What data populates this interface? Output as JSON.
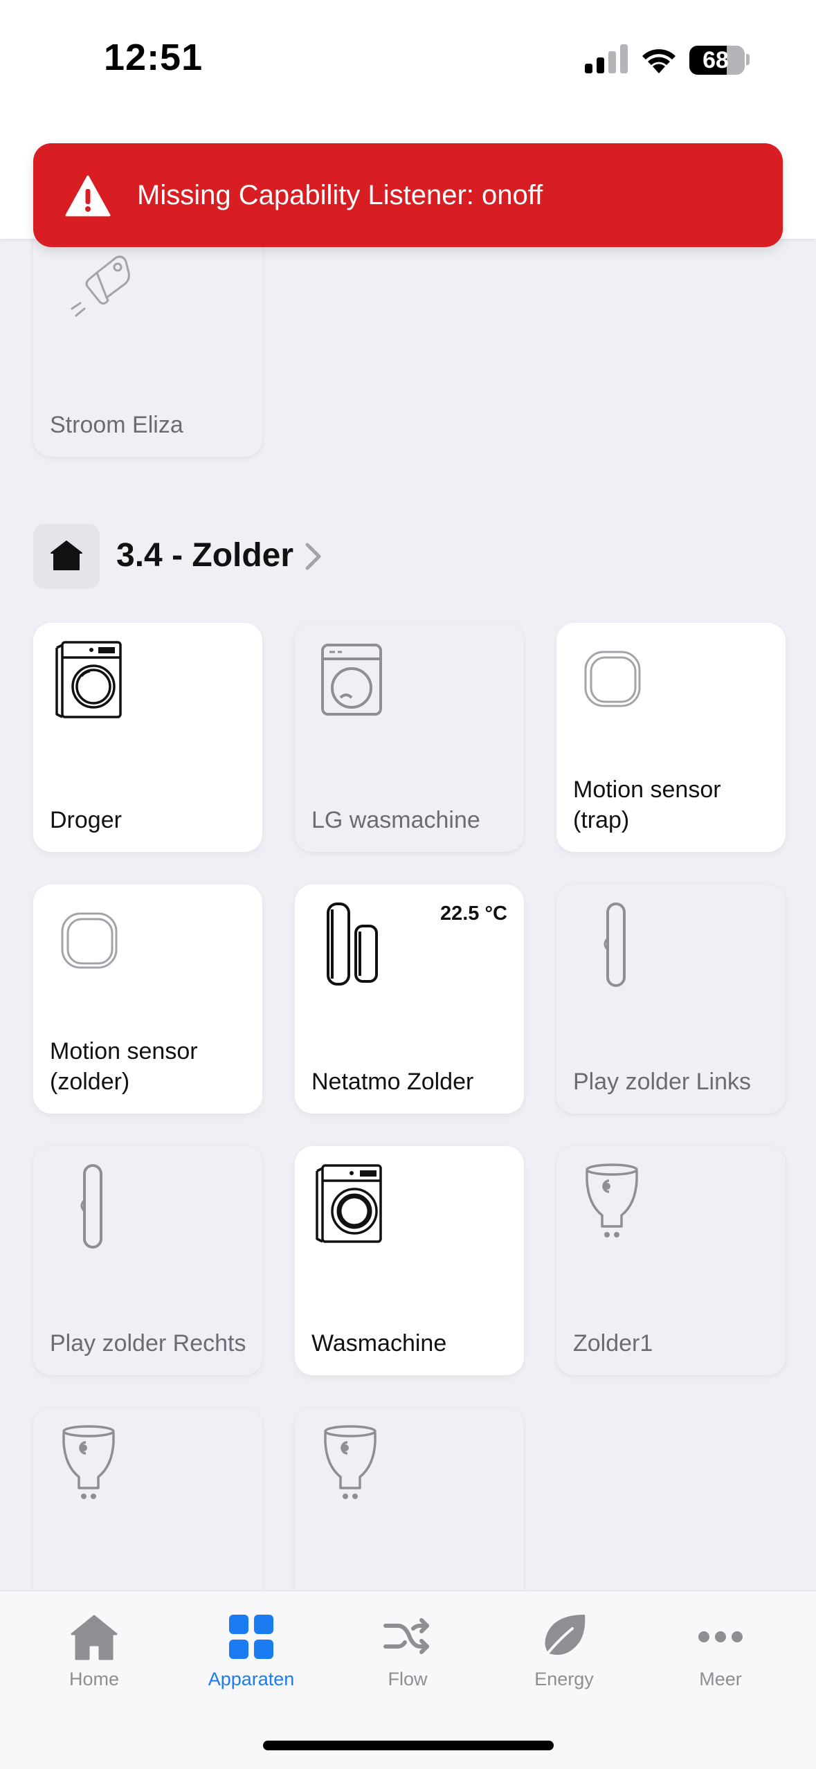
{
  "status_bar": {
    "time": "12:51",
    "battery_level": "68"
  },
  "alert": {
    "icon": "warning-triangle-icon",
    "message": "Missing Capability Listener: onoff"
  },
  "partial_tile": {
    "name": "Stroom Eliza",
    "icon": "smart-plug-icon",
    "state": "off"
  },
  "zone": {
    "icon": "home-icon",
    "title": "3.4 - Zolder"
  },
  "devices": [
    {
      "name": "Droger",
      "icon": "dryer-icon",
      "state": "on"
    },
    {
      "name": "LG wasmachine",
      "icon": "washing-machine-icon",
      "state": "off"
    },
    {
      "name": "Motion sensor (trap)",
      "icon": "motion-sensor-icon",
      "state": "on"
    },
    {
      "name": "Motion sensor (zolder)",
      "icon": "motion-sensor-icon",
      "state": "on"
    },
    {
      "name": "Netatmo Zolder",
      "icon": "weather-station-icon",
      "state": "on",
      "reading": "22.5 °C"
    },
    {
      "name": "Play zolder Links",
      "icon": "speaker-icon",
      "state": "off"
    },
    {
      "name": "Play zolder Rechts",
      "icon": "speaker-icon",
      "state": "off"
    },
    {
      "name": "Wasmachine",
      "icon": "washing-machine-icon",
      "state": "on"
    },
    {
      "name": "Zolder1",
      "icon": "spotlight-bulb-icon",
      "state": "off"
    },
    {
      "name": "",
      "icon": "spotlight-bulb-icon",
      "state": "off"
    },
    {
      "name": "",
      "icon": "spotlight-bulb-icon",
      "state": "off"
    }
  ],
  "tabbar": {
    "tabs": [
      {
        "label": "Home",
        "icon": "home-icon",
        "active": false
      },
      {
        "label": "Apparaten",
        "icon": "devices-grid-icon",
        "active": true
      },
      {
        "label": "Flow",
        "icon": "shuffle-icon",
        "active": false
      },
      {
        "label": "Energy",
        "icon": "leaf-icon",
        "active": false
      },
      {
        "label": "Meer",
        "icon": "more-dots-icon",
        "active": false
      }
    ]
  },
  "colors": {
    "accent": "#1a7cf0",
    "alert": "#d81e22",
    "background": "#eff0f5"
  }
}
